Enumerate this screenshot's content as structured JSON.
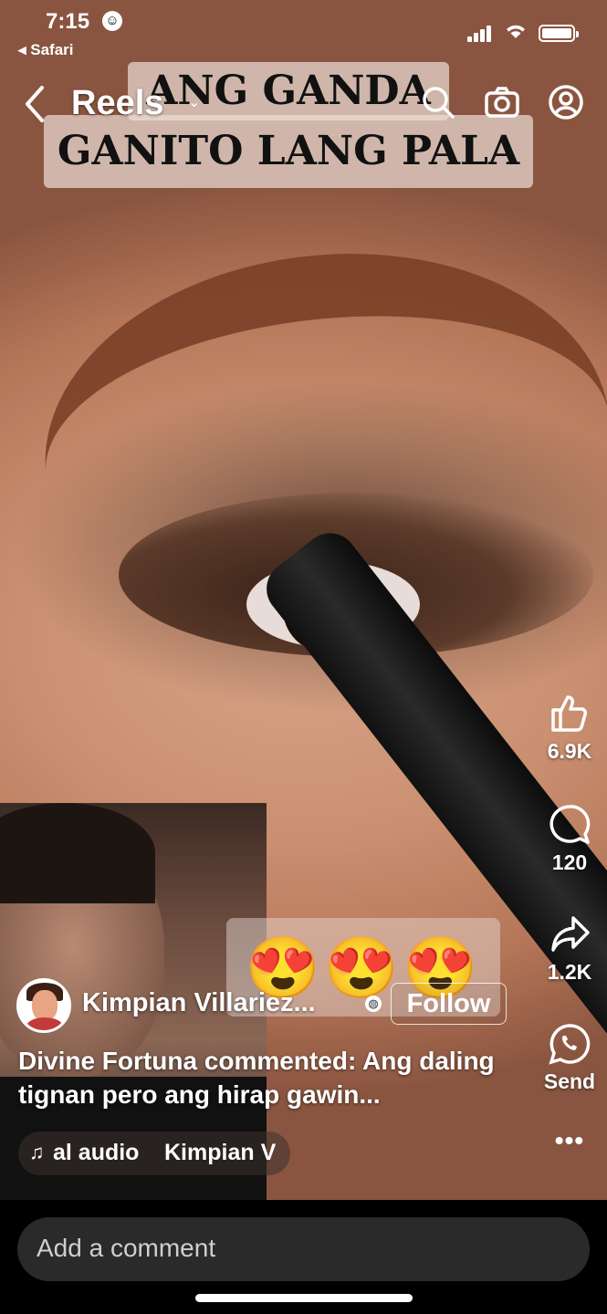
{
  "status_bar": {
    "time": "7:15",
    "back_app": "◂ Safari"
  },
  "header": {
    "title": "Reels",
    "caret": "⌄"
  },
  "video": {
    "overlay_line1": "ANG GANDA",
    "overlay_line2": "GANITO LANG PALA",
    "emojis": "😍😍😍"
  },
  "rail": {
    "likes": "6.9K",
    "comments": "120",
    "shares": "1.2K",
    "send_label": "Send",
    "more": "•••"
  },
  "author": {
    "name": "Kimpian Villariez...",
    "follow_label": "Follow"
  },
  "caption": "Divine Fortuna commented: Ang daling tignan pero ang hirap gawin...",
  "audio": {
    "note": "♫",
    "text": "al audio",
    "artist": "Kimpian V"
  },
  "comment": {
    "placeholder": "Add a comment"
  },
  "icons": [
    "chevron-left-icon",
    "search-icon",
    "camera-icon",
    "profile-icon",
    "like-icon",
    "comment-icon",
    "share-icon",
    "whatsapp-icon",
    "more-icon",
    "music-note-icon",
    "globe-icon"
  ],
  "colors": {
    "comment_bar_bg": "#2a2a2a",
    "text": "#ffffff"
  }
}
